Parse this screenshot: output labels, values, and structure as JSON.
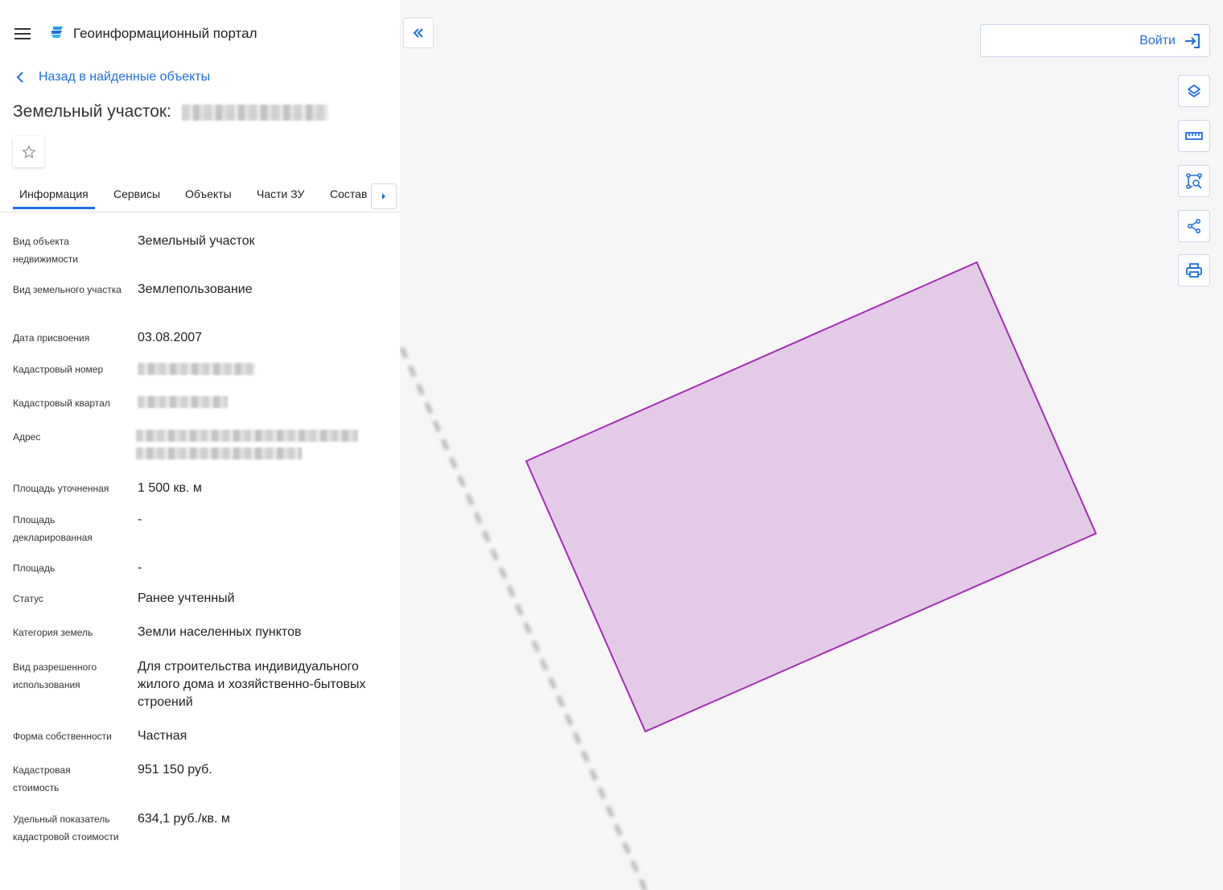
{
  "header": {
    "menu_icon": "hamburger-icon",
    "logo_icon": "portal-logo-icon",
    "title": "Геоинформационный портал"
  },
  "nav": {
    "back_label": "Назад в найденные объекты"
  },
  "object": {
    "title_prefix": "Земельный участок:",
    "favorite_icon": "star-icon"
  },
  "tabs": [
    {
      "label": "Информация",
      "active": true
    },
    {
      "label": "Сервисы",
      "active": false
    },
    {
      "label": "Объекты",
      "active": false
    },
    {
      "label": "Части ЗУ",
      "active": false
    },
    {
      "label": "Состав",
      "active": false
    }
  ],
  "details": [
    {
      "label": "Вид объекта недвижимости",
      "value": "Земельный участок"
    },
    {
      "label": "Вид земельного участка",
      "value": "Землепользование"
    },
    {
      "label": "Дата присвоения",
      "value": "03.08.2007"
    },
    {
      "label": "Кадастровый номер",
      "value": ""
    },
    {
      "label": "Кадастровый квартал",
      "value": ""
    },
    {
      "label": "Адрес",
      "value": ""
    },
    {
      "label": "Площадь уточненная",
      "value": "1 500 кв. м"
    },
    {
      "label": "Площадь декларированная",
      "value": "-"
    },
    {
      "label": "Площадь",
      "value": "-"
    },
    {
      "label": "Статус",
      "value": "Ранее учтенный"
    },
    {
      "label": "Категория земель",
      "value": "Земли населенных пунктов"
    },
    {
      "label": "Вид разрешенного использования",
      "value": "Для строительства индивидуального жилого дома и хозяйственно-бытовых строений"
    },
    {
      "label": "Форма собственности",
      "value": "Частная"
    },
    {
      "label": "Кадастровая стоимость",
      "value": "951 150 руб."
    },
    {
      "label": "Удельный показатель кадастровой стоимости",
      "value": "634,1 руб./кв. м"
    }
  ],
  "map": {
    "login_label": "Войти",
    "login_icon": "login-icon",
    "collapse_icon": "double-chevron-left-icon",
    "tools": [
      "layers-icon",
      "ruler-icon",
      "area-search-icon",
      "share-icon",
      "print-icon"
    ],
    "parcel_fill": "#e3cbe7",
    "parcel_stroke": "#a42db5",
    "background": "#f6f6f6"
  },
  "colors": {
    "accent": "#1d6fe0"
  }
}
